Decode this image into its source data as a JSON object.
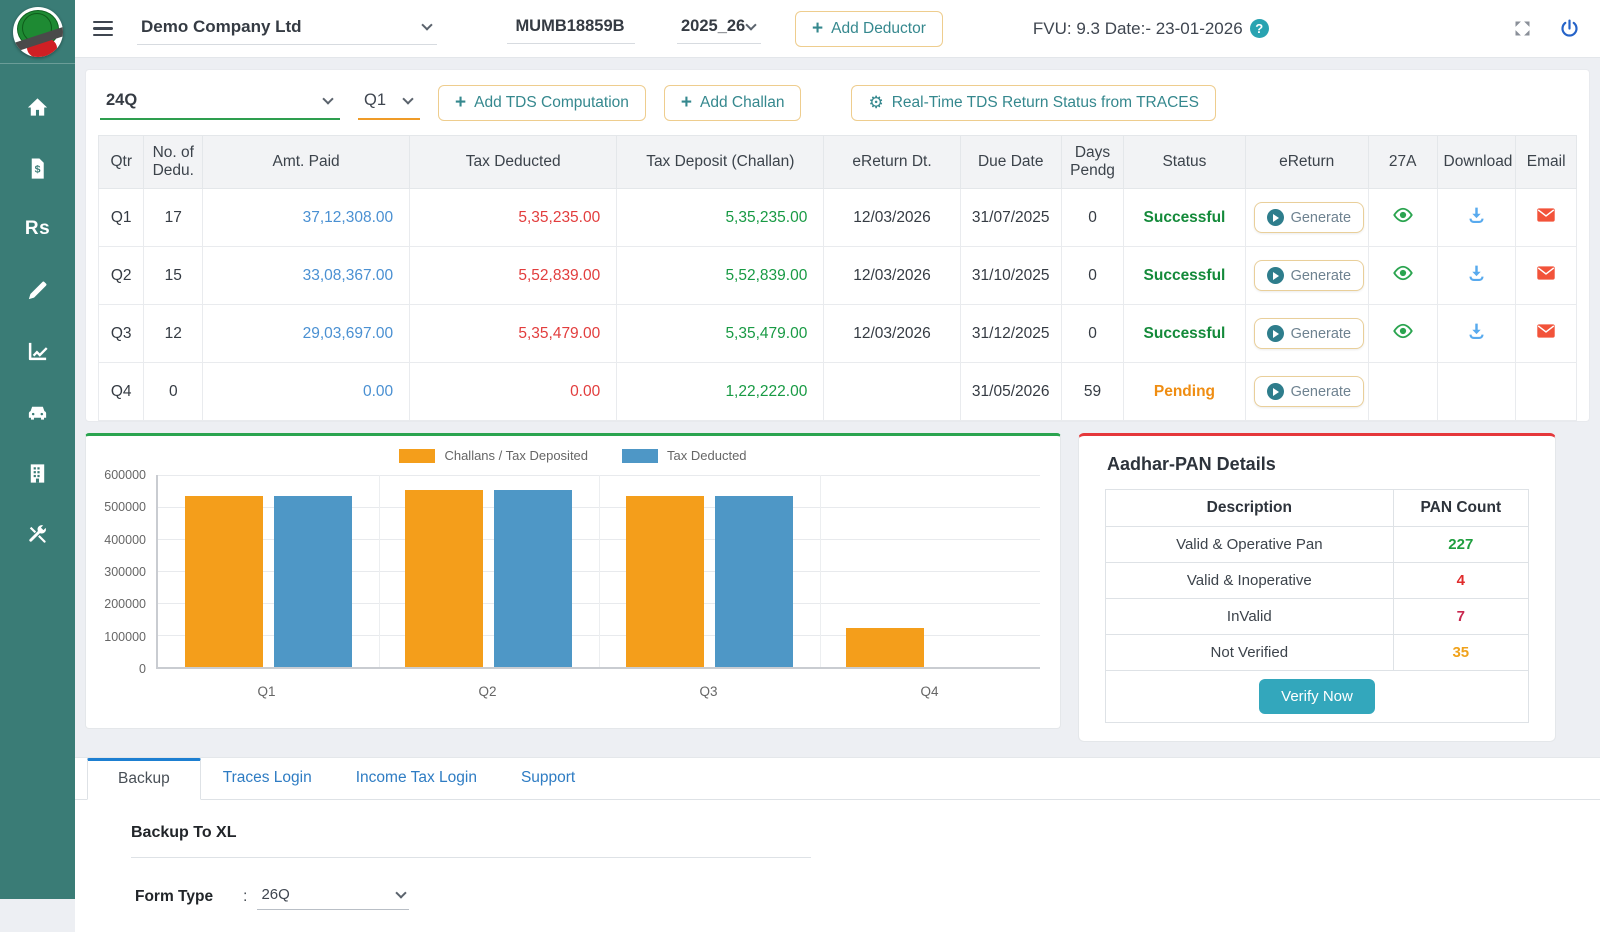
{
  "header": {
    "company_name": "Demo Company Ltd",
    "tan": "MUMB18859B",
    "assessment_year": "2025_26",
    "add_deductor": "Add Deductor",
    "plus": "+",
    "fvu_info": "FVU: 9.3 Date:- 23-01-2026",
    "help_glyph": "?"
  },
  "sidebar": {
    "rupee_label": "Rs"
  },
  "toolbar": {
    "form_type": "24Q",
    "quarter": "Q1",
    "plus": "+",
    "gear": "⚙",
    "add_tds_computation": "Add TDS Computation",
    "add_challan": "Add Challan",
    "traces_status": "Real-Time TDS Return Status from TRACES"
  },
  "quarters_table": {
    "headers": [
      "Qtr",
      "No. of Dedu.",
      "Amt. Paid",
      "Tax Deducted",
      "Tax Deposit (Challan)",
      "eReturn Dt.",
      "Due Date",
      "Days Pendg",
      "Status",
      "eReturn",
      "27A",
      "Download",
      "Email"
    ],
    "generate_label": "Generate",
    "rows": [
      {
        "qtr": "Q1",
        "dedu": "17",
        "amt_paid": "37,12,308.00",
        "tax_deducted": "5,35,235.00",
        "tax_deposit": "5,35,235.00",
        "ereturn_dt": "12/03/2026",
        "due_date": "31/07/2025",
        "days_pendg": "0",
        "status": "Successful",
        "status_color": "#148a3a"
      },
      {
        "qtr": "Q2",
        "dedu": "15",
        "amt_paid": "33,08,367.00",
        "tax_deducted": "5,52,839.00",
        "tax_deposit": "5,52,839.00",
        "ereturn_dt": "12/03/2026",
        "due_date": "31/10/2025",
        "days_pendg": "0",
        "status": "Successful",
        "status_color": "#148a3a"
      },
      {
        "qtr": "Q3",
        "dedu": "12",
        "amt_paid": "29,03,697.00",
        "tax_deducted": "5,35,479.00",
        "tax_deposit": "5,35,479.00",
        "ereturn_dt": "12/03/2026",
        "due_date": "31/12/2025",
        "days_pendg": "0",
        "status": "Successful",
        "status_color": "#148a3a"
      },
      {
        "qtr": "Q4",
        "dedu": "0",
        "amt_paid": "0.00",
        "tax_deducted": "0.00",
        "tax_deposit": "1,22,222.00",
        "ereturn_dt": "",
        "due_date": "31/05/2026",
        "days_pendg": "59",
        "status": "Pending",
        "status_color": "#ef8d12"
      }
    ]
  },
  "chart_data": {
    "type": "bar",
    "categories": [
      "Q1",
      "Q2",
      "Q3",
      "Q4"
    ],
    "series": [
      {
        "name": "Challans / Tax Deposited",
        "color": "#f49e1b",
        "values": [
          535235,
          552839,
          535479,
          122222
        ]
      },
      {
        "name": "Tax Deducted",
        "color": "#4e97c6",
        "values": [
          535235,
          552839,
          535479,
          0
        ]
      }
    ],
    "title": "",
    "xlabel": "",
    "ylabel": "",
    "ylim": [
      0,
      600000
    ],
    "ytick_step": 100000,
    "grid": true,
    "legend_position": "top"
  },
  "pan_panel": {
    "title": "Aadhar-PAN Details",
    "headers": [
      "Description",
      "PAN Count"
    ],
    "rows": [
      {
        "label": "Valid & Operative Pan",
        "count": "227",
        "color": "#1e9e3e"
      },
      {
        "label": "Valid & Inoperative",
        "count": "4",
        "color": "#e02b2b"
      },
      {
        "label": "InValid",
        "count": "7",
        "color": "#c9274e"
      },
      {
        "label": "Not Verified",
        "count": "35",
        "color": "#f0a21b"
      }
    ],
    "verify_button": "Verify Now"
  },
  "bottom": {
    "tabs": [
      "Backup",
      "Traces Login",
      "Income Tax Login",
      "Support"
    ],
    "active_tab": "Backup",
    "section_title": "Backup To XL",
    "form_type_label": "Form Type",
    "colon": ":",
    "form_type_value": "26Q"
  }
}
